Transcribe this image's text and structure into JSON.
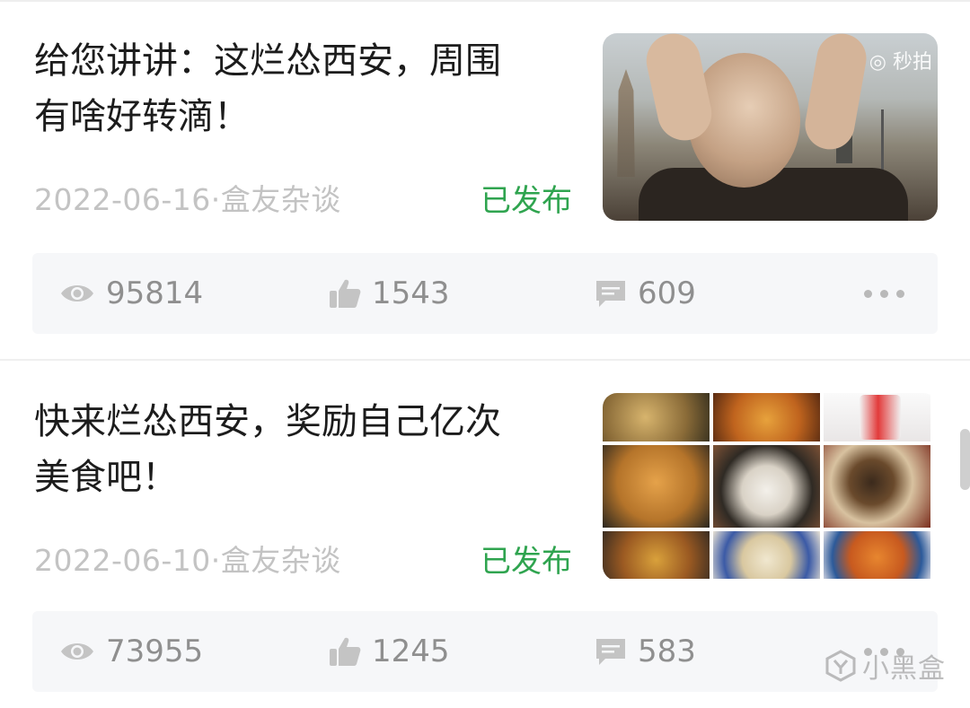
{
  "posts": [
    {
      "title_line1": "给您讲讲：这烂怂西安，周围",
      "title_line2": "有啥好转滴！",
      "date": "2022-06-16",
      "category": "·盒友杂谈",
      "status": "已发布",
      "thumbnail_watermark": "◎ 秒拍",
      "views": "95814",
      "likes": "1543",
      "comments": "609"
    },
    {
      "title_line1": "快来烂怂西安，奖励自己亿次",
      "title_line2": "美食吧！",
      "date": "2022-06-10",
      "category": "·盒友杂谈",
      "status": "已发布",
      "views": "73955",
      "likes": "1245",
      "comments": "583"
    }
  ],
  "colors": {
    "status_green": "#2fa44f",
    "meta_gray": "#c3c3c3",
    "stats_bg": "#f6f7f9"
  },
  "icons": {
    "views": "eye-icon",
    "likes": "thumbs-up-icon",
    "comments": "comment-icon",
    "more": "more-dots-icon"
  },
  "watermark": {
    "brand_text": "小黑盒"
  }
}
